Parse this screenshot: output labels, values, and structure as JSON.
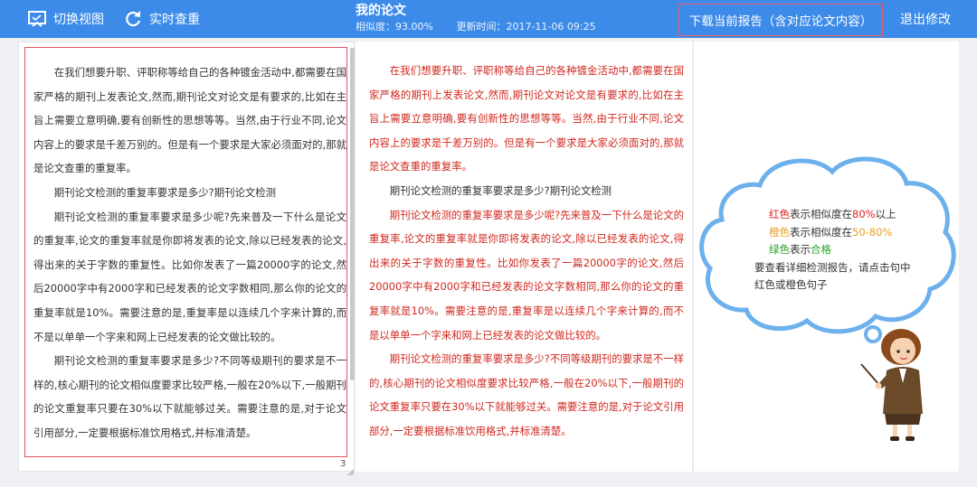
{
  "toolbar": {
    "switch_view": "切换视图",
    "realtime_check": "实时查重",
    "title": "我的论文",
    "similarity": "相似度：93.00%",
    "update_time": "更新时间：2017-11-06 09:25",
    "download_report": "下载当前报告（含对应论文内容）",
    "exit_edit": "退出修改"
  },
  "colors": {
    "accent": "#3c8be8",
    "highlight_red": "#d0281f",
    "frame_red": "#e0535f"
  },
  "left_panel": {
    "paragraphs": [
      "在我们想要升职、评职称等给自己的各种镀金活动中,都需要在国家严格的期刊上发表论文,然而,期刊论文对论文是有要求的,比如在主旨上需要立意明确,要有创新性的思想等等。当然,由于行业不同,论文内容上的要求是千差万别的。但是有一个要求是大家必须面对的,那就是论文查重的重复率。",
      "期刊论文检测的重复率要求是多少?期刊论文检测",
      "期刊论文检测的重复率要求是多少呢?先来普及一下什么是论文的重复率,论文的重复率就是你即将发表的论文,除以已经发表的论文,得出来的关于字数的重复性。比如你发表了一篇20000字的论文,然后20000字中有2000字和已经发表的论文字数相同,那么你的论文的重复率就是10%。需要注意的是,重复率是以连续几个字来计算的,而不是以单单一个字来和网上已经发表的论文做比较的。",
      "期刊论文检测的重复率要求是多少?不同等级期刊的要求是不一样的,核心期刊的论文相似度要求比较严格,一般在20%以下,一般期刊的论文重复率只要在30%以下就能够过关。需要注意的是,对于论文引用部分,一定要根据标准饮用格式,并标准清楚。"
    ],
    "page_number": "3"
  },
  "mid_panel": {
    "paragraphs": [
      "在我们想要升职、评职称等给自己的各种镀金活动中,都需要在国家严格的期刊上发表论文,然而,期刊论文对论文是有要求的,比如在主旨上需要立意明确,要有创新性的思想等等。当然,由于行业不同,论文内容上的要求是千差万别的。但是有一个要求是大家必须面对的,那就是论文查重的重复率。",
      "期刊论文检测的重复率要求是多少?期刊论文检测",
      "期刊论文检测的重复率要求是多少呢?先来普及一下什么是论文的重复率,论文的重复率就是你即将发表的论文,除以已经发表的论文,得出来的关于字数的重复性。比如你发表了一篇20000字的论文,然后20000字中有2000字和已经发表的论文字数相同,那么你的论文的重复率就是10%。需要注意的是,重复率是以连续几个字来计算的,而不是以单单一个字来和网上已经发表的论文做比较的。",
      "期刊论文检测的重复率要求是多少?不同等级期刊的要求是不一样的,核心期刊的论文相似度要求比较严格,一般在20%以下,一般期刊的论文重复率只要在30%以下就能够过关。需要注意的是,对于论文引用部分,一定要根据标准饮用格式,并标准清楚。"
    ]
  },
  "legend": {
    "red_word": "红色",
    "red_text": "表示相似度在",
    "red_value": "80%",
    "red_suffix": "以上",
    "orange_word": "橙色",
    "orange_text": "表示相似度在",
    "orange_value": "50-80%",
    "green_word": "绿色",
    "green_text": "表示",
    "green_value": "合格",
    "hint_line1": "要查看详细检测报告，请点击句中",
    "hint_line2": "红色或橙色句子"
  }
}
